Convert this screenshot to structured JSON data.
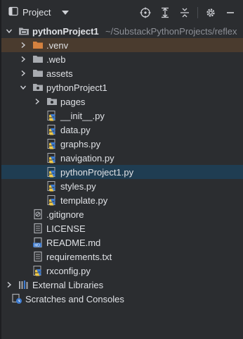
{
  "toolbar": {
    "title": "Project",
    "icons": [
      "window-icon",
      "locate-icon",
      "expand-all-icon",
      "collapse-all-icon",
      "gear-icon",
      "hide-icon"
    ]
  },
  "tree": {
    "root": {
      "name": "pythonProject1",
      "path": "~/SubstackPythonProjects/reflex"
    },
    "items": [
      {
        "label": ".venv"
      },
      {
        "label": ".web"
      },
      {
        "label": "assets"
      },
      {
        "label": "pythonProject1"
      },
      {
        "label": "pages"
      },
      {
        "label": "__init__.py"
      },
      {
        "label": "data.py"
      },
      {
        "label": "graphs.py"
      },
      {
        "label": "navigation.py"
      },
      {
        "label": "pythonProject1.py"
      },
      {
        "label": "styles.py"
      },
      {
        "label": "template.py"
      },
      {
        "label": ".gitignore"
      },
      {
        "label": "LICENSE"
      },
      {
        "label": "README.md"
      },
      {
        "label": "requirements.txt"
      },
      {
        "label": "rxconfig.py"
      },
      {
        "label": "External Libraries"
      },
      {
        "label": "Scratches and Consoles"
      }
    ]
  },
  "colors": {
    "background": "#2b2d30",
    "selected": "#1f3d52",
    "venv": "#4a3b2e",
    "folder": "#a8abb0",
    "venv_folder": "#d4813f"
  }
}
